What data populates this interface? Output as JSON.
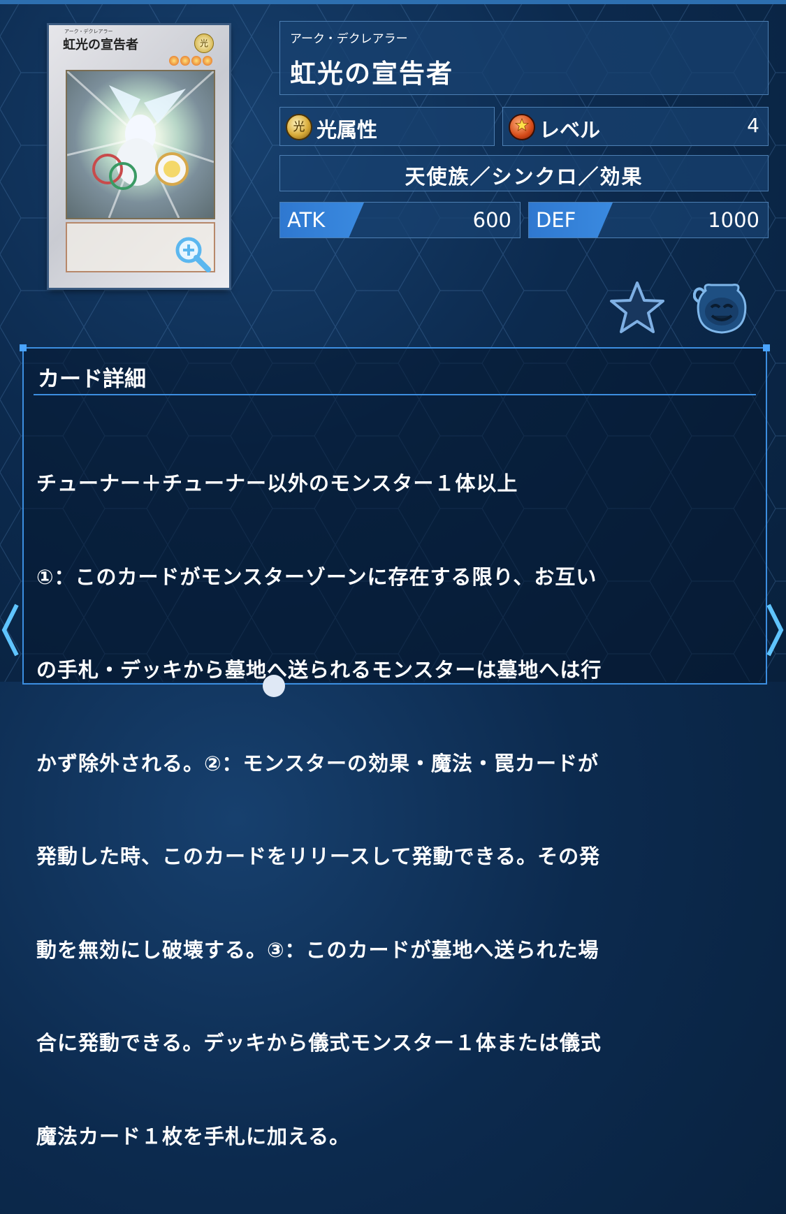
{
  "card": {
    "image_name": "虹光の宣告者",
    "image_ruby": "アーク・デクレアラー",
    "attribute_glyph": "光"
  },
  "monster": {
    "ruby": "アーク・デクレアラー",
    "name": "虹光の宣告者",
    "attribute": "光属性",
    "level_label": "レベル",
    "level_value": "4",
    "type_line": "天使族／シンクロ／効果",
    "atk_label": "ATK",
    "atk_value": "600",
    "def_label": "DEF",
    "def_value": "1000"
  },
  "detail": {
    "title": "カード詳細",
    "lines": [
      "チューナー＋チューナー以外のモンスター１体以上",
      "①：このカードがモンスターゾーンに存在する限り、お互い",
      "の手札・デッキから墓地へ送られるモンスターは墓地へは行",
      "かず除外される。②：モンスターの効果・魔法・罠カードが",
      "発動した時、このカードをリリースして発動できる。その発",
      "動を無効にし破壊する。③：このカードが墓地へ送られた場",
      "合に発動できる。デッキから儀式モンスター１体または儀式",
      "魔法カード１枚を手札に加える。"
    ]
  },
  "colors": {
    "background": "#0c2a4e",
    "panel": "#184270",
    "accent": "#3a8ae0",
    "border": "#3c8ee0"
  },
  "icons": {
    "zoom": "zoom-in-icon",
    "favorite": "star-icon",
    "pot": "pot-of-greed-icon",
    "prev": "chevron-left-icon",
    "next": "chevron-right-icon"
  }
}
